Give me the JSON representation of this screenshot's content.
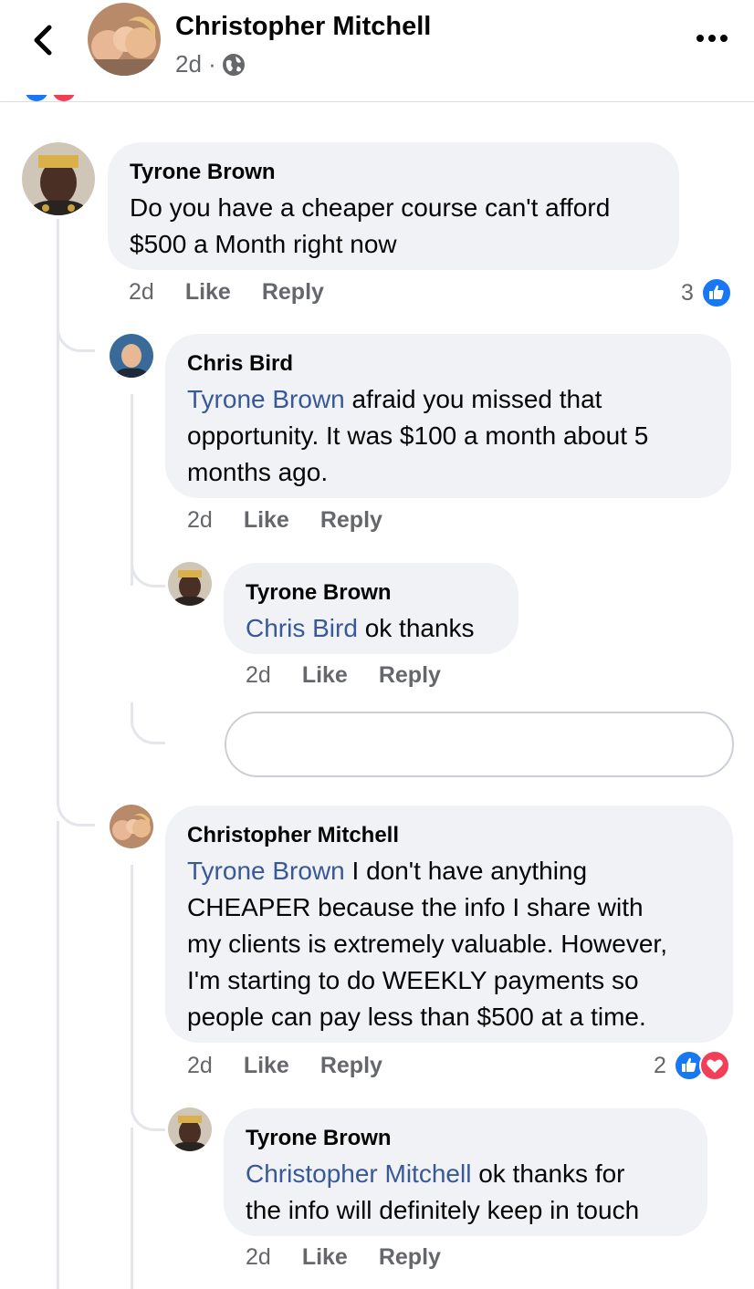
{
  "header": {
    "name": "Christopher Mitchell",
    "time": "2d ·"
  },
  "comments": [
    {
      "author": "Tyrone Brown",
      "mention": "",
      "text_line1": "Do you have a cheaper course can't afford",
      "text_line2": "$500 a Month right now",
      "time": "2d",
      "like_label": "Like",
      "reply_label": "Reply",
      "reaction_count": "3"
    },
    {
      "author": "Chris Bird",
      "mention": "Tyrone Brown",
      "text_line1": " afraid you missed that",
      "text_line2": "opportunity.  It was $100 a month about 5",
      "text_line3": "months ago.",
      "time": "2d",
      "like_label": "Like",
      "reply_label": "Reply"
    },
    {
      "author": "Tyrone Brown",
      "mention": "Chris Bird",
      "text_line1": " ok thanks",
      "time": "2d",
      "like_label": "Like",
      "reply_label": "Reply"
    },
    {
      "author": "Christopher Mitchell",
      "mention": "Tyrone Brown",
      "text_line1": " I don't have anything",
      "text_line2": "CHEAPER because the info I share with",
      "text_line3": "my clients is extremely valuable. However,",
      "text_line4": "I'm starting to do WEEKLY payments so",
      "text_line5": "people can pay less than $500 at a time.",
      "time": "2d",
      "like_label": "Like",
      "reply_label": "Reply",
      "reaction_count": "2"
    },
    {
      "author": "Tyrone Brown",
      "mention": "Christopher Mitchell",
      "text_line1": " ok thanks for",
      "text_line2": "the info will definitely keep in touch",
      "time": "2d",
      "like_label": "Like",
      "reply_label": "Reply"
    }
  ],
  "colors": {
    "mention": "#385898",
    "bubble": "#f0f2f5",
    "like": "#1877f2",
    "love": "#f33e58",
    "muted": "#65676b"
  }
}
